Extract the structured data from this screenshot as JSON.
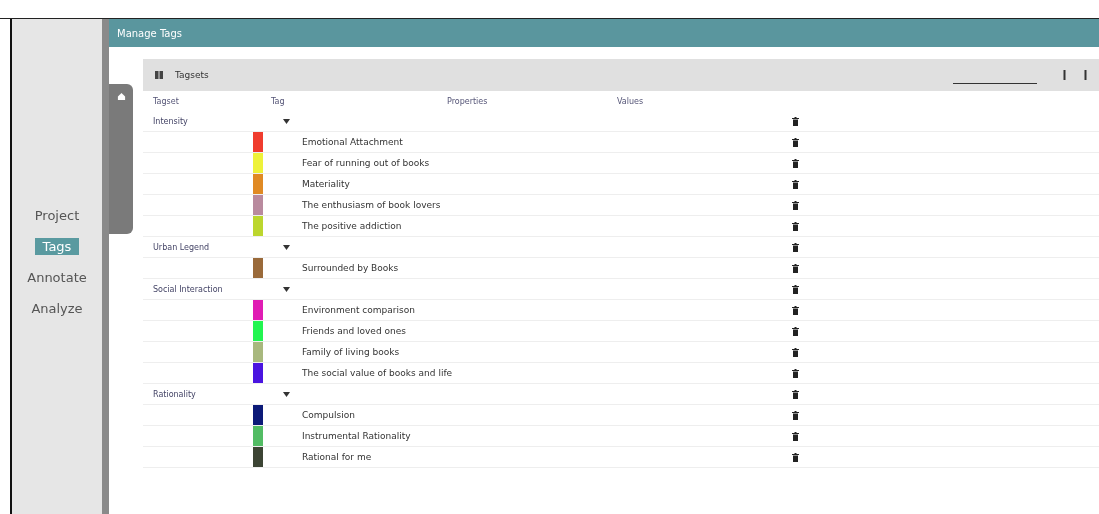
{
  "header": {
    "title": "Manage Tags"
  },
  "sidebar": {
    "items": [
      {
        "label": "Project",
        "selected": false
      },
      {
        "label": "Tags",
        "selected": true
      },
      {
        "label": "Annotate",
        "selected": false
      },
      {
        "label": "Analyze",
        "selected": false
      }
    ]
  },
  "toolbar": {
    "title": "Tagsets"
  },
  "table": {
    "columns": [
      "Tagset",
      "Tag",
      "Properties",
      "Values"
    ],
    "groups": [
      {
        "name": "Intensity",
        "tags": [
          {
            "name": "Emotional Attachment",
            "color": "#f03c2e"
          },
          {
            "name": "Fear of running out of books",
            "color": "#eef23a"
          },
          {
            "name": "Materiality",
            "color": "#e08a24"
          },
          {
            "name": "The enthusiasm of book lovers",
            "color": "#b98a9e"
          },
          {
            "name": "The positive addiction",
            "color": "#bcd62e"
          }
        ]
      },
      {
        "name": "Urban Legend",
        "tags": [
          {
            "name": "Surrounded by Books",
            "color": "#9a6a3a"
          }
        ]
      },
      {
        "name": "Social Interaction",
        "tags": [
          {
            "name": "Environment comparison",
            "color": "#e01cb4"
          },
          {
            "name": "Friends and loved ones",
            "color": "#22f550"
          },
          {
            "name": "Family of living books",
            "color": "#a8b87e"
          },
          {
            "name": "The social value of books and life",
            "color": "#4a14e0"
          }
        ]
      },
      {
        "name": "Rationality",
        "tags": [
          {
            "name": "Compulsion",
            "color": "#0c1a78"
          },
          {
            "name": "Instrumental Rationality",
            "color": "#52bc64"
          },
          {
            "name": "Rational for me",
            "color": "#3c4434"
          }
        ]
      }
    ]
  }
}
